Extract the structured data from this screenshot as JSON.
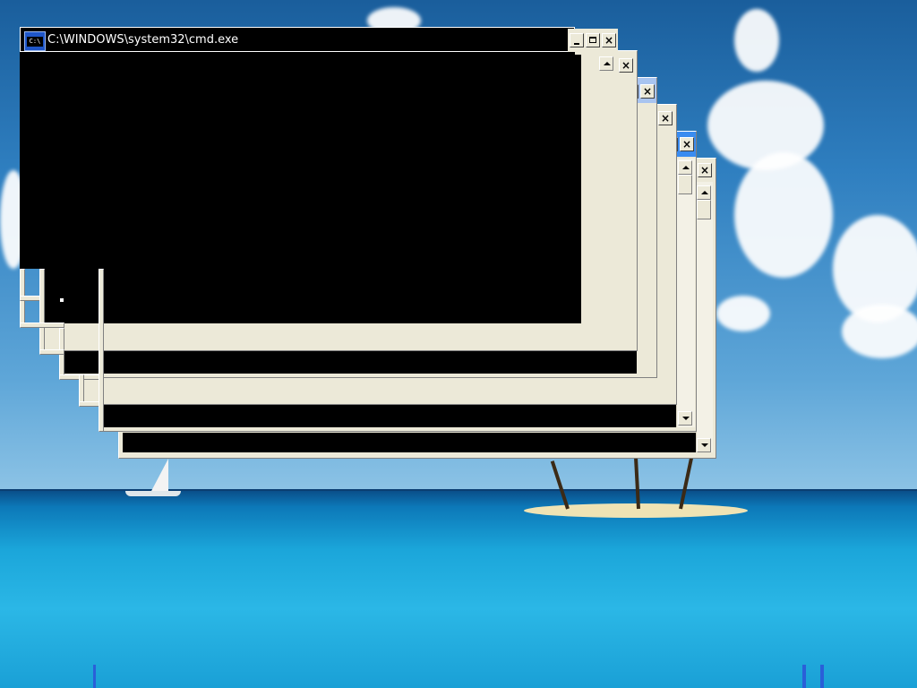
{
  "desktop": {
    "wallpaper": "tropical-island-ocean"
  },
  "windows": {
    "front": {
      "title": "C:\\WINDOWS\\system32\\cmd.exe",
      "icon_label": "C:\\",
      "titlebar_color": "#000000"
    }
  },
  "colors": {
    "window_face": "#ece9d8",
    "active_title": "#3a8cf0",
    "inactive_title": "#a8c4f0",
    "console_bg": "#000000",
    "sky": "#2f7fc0",
    "sea": "#1ba6da"
  }
}
